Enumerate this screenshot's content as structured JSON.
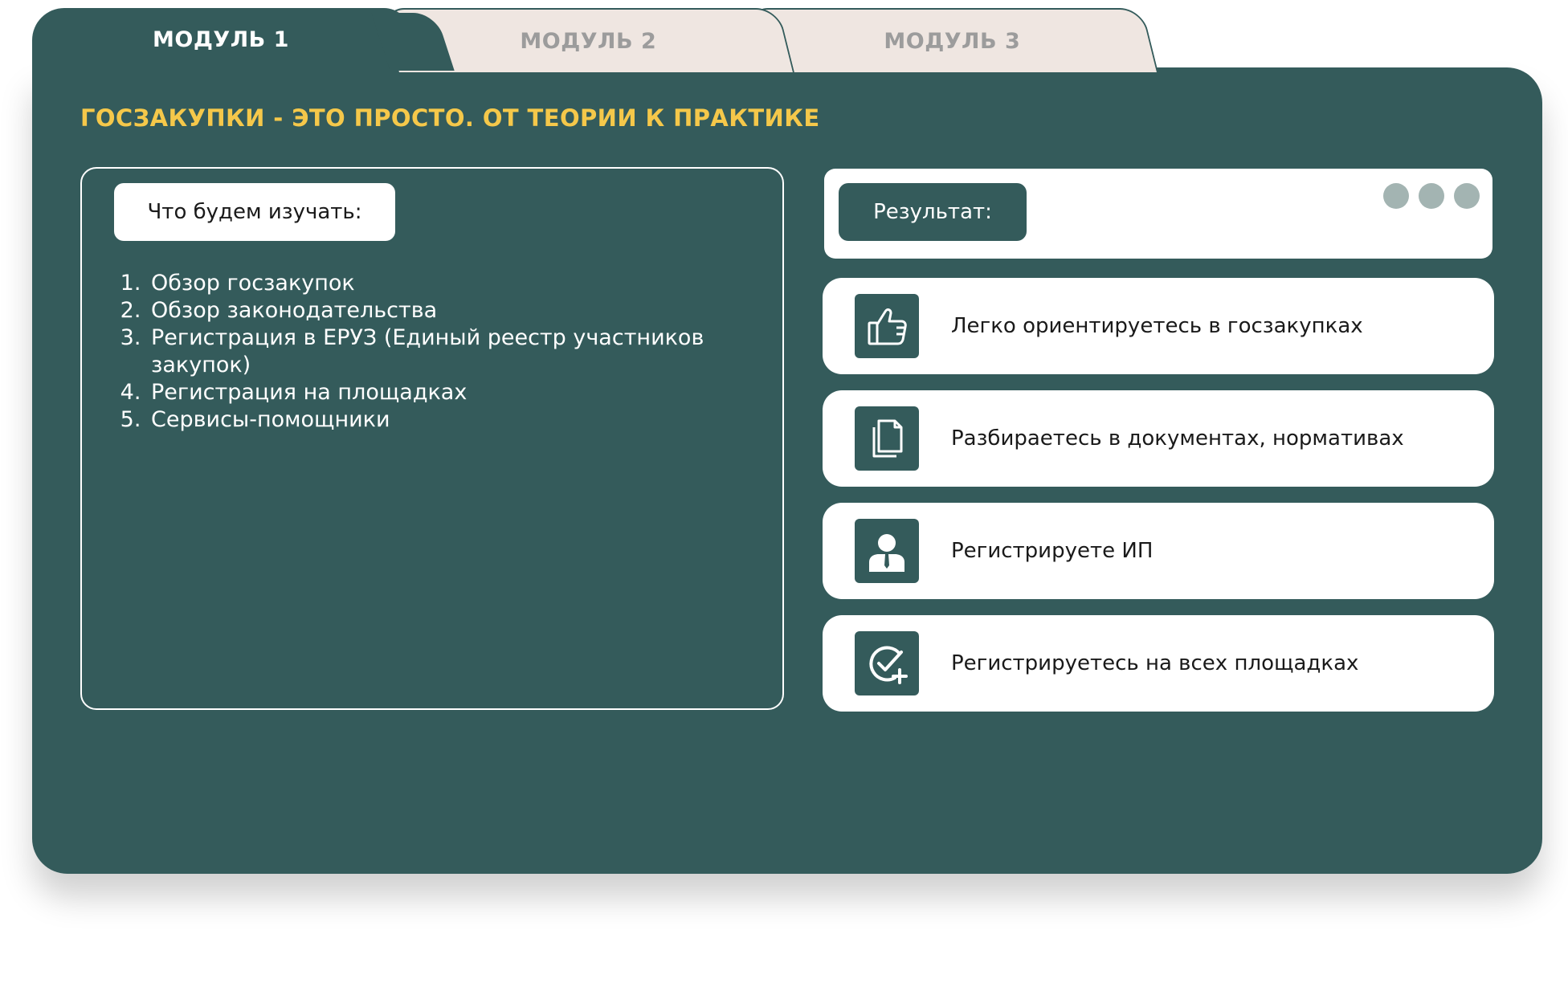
{
  "tabs": [
    {
      "label": "МОДУЛЬ 1",
      "active": true
    },
    {
      "label": "МОДУЛЬ 2",
      "active": false
    },
    {
      "label": "МОДУЛЬ 3",
      "active": false
    }
  ],
  "panel": {
    "heading": "ГОСЗАКУПКИ -  ЭТО ПРОСТО. ОТ ТЕОРИИ К ПРАКТИКЕ",
    "study": {
      "label": "Что будем изучать:",
      "items": [
        "Обзор госзакупок",
        "Обзор законодательства",
        "Регистрация в ЕРУЗ (Единый реестр участников закупок)",
        "Регистрация на площадках",
        "Сервисы-помощники"
      ]
    },
    "results": {
      "label": "Результат:",
      "items": [
        {
          "icon": "thumbs-up-icon",
          "text": "Легко ориентируетесь в госзакупках"
        },
        {
          "icon": "documents-icon",
          "text": "Разбираетесь в документах, нормативах"
        },
        {
          "icon": "user-icon",
          "text": "Регистрируете ИП"
        },
        {
          "icon": "check-add-icon",
          "text": "Регистрируетесь на всех площадках"
        }
      ]
    }
  },
  "colors": {
    "panel": "#345b5b",
    "accent": "#f5c84a",
    "inactive_tab": "#efe6e1",
    "dot": "#a3b4b2"
  }
}
